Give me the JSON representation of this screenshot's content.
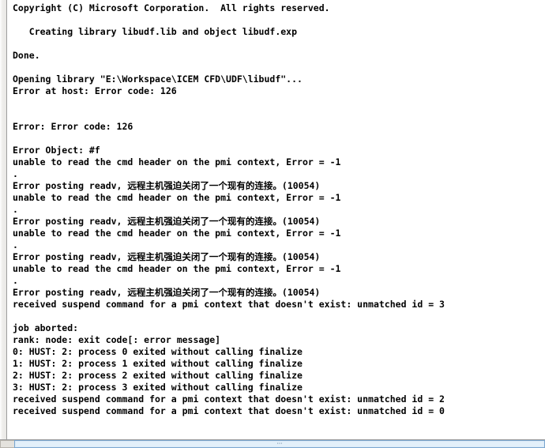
{
  "window": {
    "type": "console-output",
    "background_color": "#ffffff",
    "text_color": "#000000",
    "gutter_color": "#f1f0ee"
  },
  "console": {
    "lines": [
      "Copyright (C) Microsoft Corporation.  All rights reserved.",
      "",
      "   Creating library libudf.lib and object libudf.exp",
      "",
      "Done.",
      "",
      "Opening library \"E:\\Workspace\\ICEM CFD\\UDF\\libudf\"...",
      "Error at host: Error code: 126",
      "",
      "",
      "Error: Error code: 126",
      "",
      "Error Object: #f",
      "unable to read the cmd header on the pmi context, Error = -1",
      ".",
      "Error posting readv, 远程主机强迫关闭了一个现有的连接。(10054)",
      "unable to read the cmd header on the pmi context, Error = -1",
      ".",
      "Error posting readv, 远程主机强迫关闭了一个现有的连接。(10054)",
      "unable to read the cmd header on the pmi context, Error = -1",
      ".",
      "Error posting readv, 远程主机强迫关闭了一个现有的连接。(10054)",
      "unable to read the cmd header on the pmi context, Error = -1",
      ".",
      "Error posting readv, 远程主机强迫关闭了一个现有的连接。(10054)",
      "received suspend command for a pmi context that doesn't exist: unmatched id = 3",
      "",
      "job aborted:",
      "rank: node: exit code[: error message]",
      "0: HUST: 2: process 0 exited without calling finalize",
      "1: HUST: 2: process 1 exited without calling finalize",
      "2: HUST: 2: process 2 exited without calling finalize",
      "3: HUST: 2: process 3 exited without calling finalize",
      "received suspend command for a pmi context that doesn't exist: unmatched id = 2",
      "received suspend command for a pmi context that doesn't exist: unmatched id = 0"
    ]
  },
  "bottom_strip": {
    "corner_label": "",
    "bar_glyph": "···"
  }
}
